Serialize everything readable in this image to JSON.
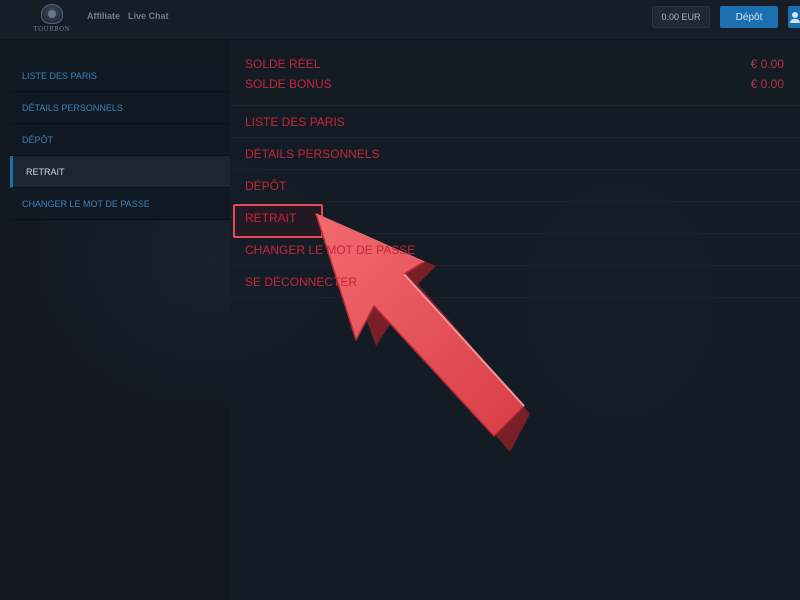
{
  "header": {
    "logo_text": "TOURBON",
    "nav": [
      "Affiliate",
      "Live Chat"
    ],
    "balance": "0.00 EUR",
    "deposit_label": "Dépôt"
  },
  "sidebar": {
    "items": [
      {
        "label": "LISTE DES PARIS",
        "active": false
      },
      {
        "label": "DÉTAILS PERSONNELS",
        "active": false
      },
      {
        "label": "DÉPÔT",
        "active": false
      },
      {
        "label": "RETRAIT",
        "active": true
      },
      {
        "label": "CHANGER LE MOT DE PASSE",
        "active": false
      }
    ]
  },
  "balances": {
    "real_label": "SOLDE RÉEL",
    "real_value": "€ 0.00",
    "bonus_label": "SOLDE BONUS",
    "bonus_value": "€ 0.00"
  },
  "menu": {
    "items": [
      {
        "label": "LISTE DES PARIS"
      },
      {
        "label": "DÉTAILS PERSONNELS"
      },
      {
        "label": "DÉPÔT"
      },
      {
        "label": "RETRAIT",
        "highlighted": true
      },
      {
        "label": "CHANGER LE MOT DE PASSE"
      },
      {
        "label": "SE DÉCONNECTER"
      }
    ]
  },
  "colors": {
    "accent_blue": "#1b6fae",
    "menu_red": "#c4273a",
    "annotation_arrow": "#e64b52"
  },
  "icons": [
    "user-icon"
  ]
}
